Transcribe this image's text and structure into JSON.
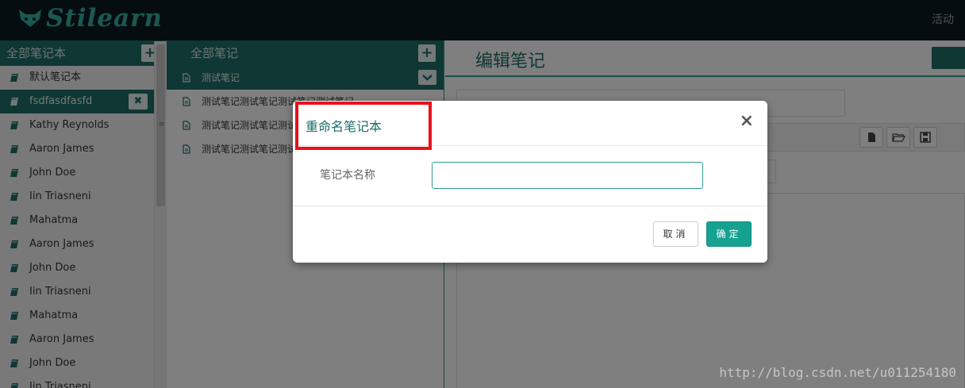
{
  "header": {
    "logo_text": "Stilearn",
    "activity_label": "活动"
  },
  "notebooks": {
    "title": "全部笔记本",
    "add_label": "+",
    "close_label": "✖",
    "items": [
      {
        "label": "默认笔记本",
        "active": false
      },
      {
        "label": "fsdfasdfasfd",
        "active": true
      },
      {
        "label": "Kathy Reynolds",
        "active": false
      },
      {
        "label": "Aaron James",
        "active": false
      },
      {
        "label": "John Doe",
        "active": false
      },
      {
        "label": "Iin Triasneni",
        "active": false
      },
      {
        "label": "Mahatma",
        "active": false
      },
      {
        "label": "Aaron James",
        "active": false
      },
      {
        "label": "John Doe",
        "active": false
      },
      {
        "label": "Iin Triasneni",
        "active": false
      },
      {
        "label": "Mahatma",
        "active": false
      },
      {
        "label": "Aaron James",
        "active": false
      },
      {
        "label": "John Doe",
        "active": false
      },
      {
        "label": "Iin Triasneni",
        "active": false
      }
    ]
  },
  "notes": {
    "title": "全部笔记",
    "add_label": "+",
    "items": [
      {
        "label": "测试笔记",
        "active": true
      },
      {
        "label": "测试笔记测试笔记测试笔记测试笔记",
        "active": false
      },
      {
        "label": "测试笔记测试笔记测试笔记",
        "active": false
      },
      {
        "label": "测试笔记测试笔记测试笔记",
        "active": false
      }
    ]
  },
  "editor": {
    "title": "编辑笔记"
  },
  "modal": {
    "title": "重命名笔记本",
    "close_label": "×",
    "field_label": "笔记本名称",
    "field_value": "",
    "cancel_label": "取消",
    "ok_label": "确定"
  },
  "watermark": "http://blog.csdn.net/u011254180",
  "colors": {
    "brand_teal": "#1e6f68",
    "accent_teal": "#15a291",
    "highlight_red": "#e8111b"
  }
}
